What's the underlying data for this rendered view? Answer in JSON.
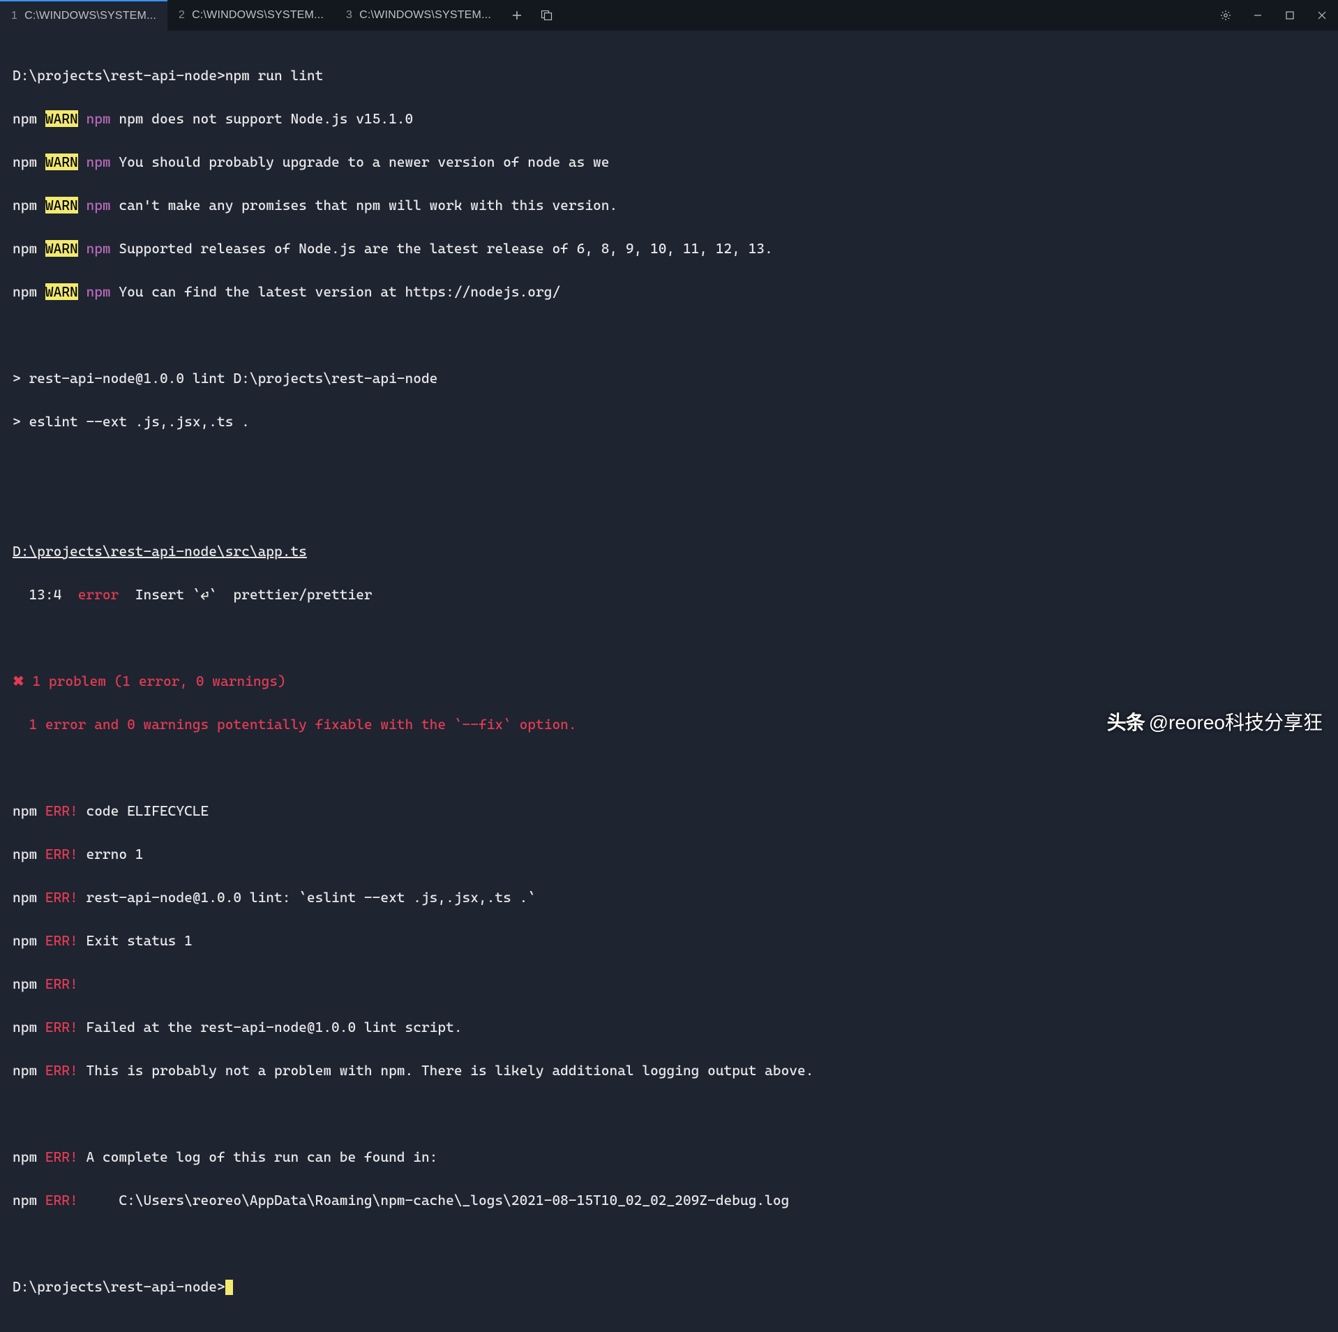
{
  "tabs": [
    {
      "num": "1",
      "title": "C:\\WINDOWS\\SYSTEM...",
      "active": true
    },
    {
      "num": "2",
      "title": "C:\\WINDOWS\\SYSTEM...",
      "active": false
    },
    {
      "num": "3",
      "title": "C:\\WINDOWS\\SYSTEM...",
      "active": false
    }
  ],
  "lines": {
    "prompt1": "D:\\projects\\rest-api-node>npm run lint",
    "warn_label": "WARN",
    "npm": "npm",
    "npm_sub": "npm",
    "warn_msgs": [
      " npm does not support Node.js v15.1.0",
      " You should probably upgrade to a newer version of node as we",
      " can't make any promises that npm will work with this version.",
      " Supported releases of Node.js are the latest release of 6, 8, 9, 10, 11, 12, 13.",
      " You can find the latest version at https://nodejs.org/"
    ],
    "script1": "> rest-api-node@1.0.0 lint D:\\projects\\rest-api-node",
    "script2": "> eslint --ext .js,.jsx,.ts .",
    "file": "D:\\projects\\rest-api-node\\src\\app.ts",
    "lint_loc": "  13:4  ",
    "lint_sev": "error",
    "lint_msg": "  Insert `⏎`  prettier/prettier",
    "cross": "✖",
    "summary1": " 1 problem (1 error, 0 warnings)",
    "summary2": "  1 error and 0 warnings potentially fixable with the `--fix` option.",
    "err_label": "ERR!",
    "err_lines": [
      " code ELIFECYCLE",
      " errno 1",
      " rest-api-node@1.0.0 lint: `eslint --ext .js,.jsx,.ts .`",
      " Exit status 1",
      "",
      " Failed at the rest-api-node@1.0.0 lint script.",
      " This is probably not a problem with npm. There is likely additional logging output above."
    ],
    "err_log1": " A complete log of this run can be found in:",
    "err_log2": "     C:\\Users\\reoreo\\AppData\\Roaming\\npm-cache\\_logs\\2021-08-15T10_02_02_209Z-debug.log",
    "prompt2": "D:\\projects\\rest-api-node>"
  },
  "watermark": {
    "logo": "头条",
    "text": "@reoreo科技分享狂"
  }
}
